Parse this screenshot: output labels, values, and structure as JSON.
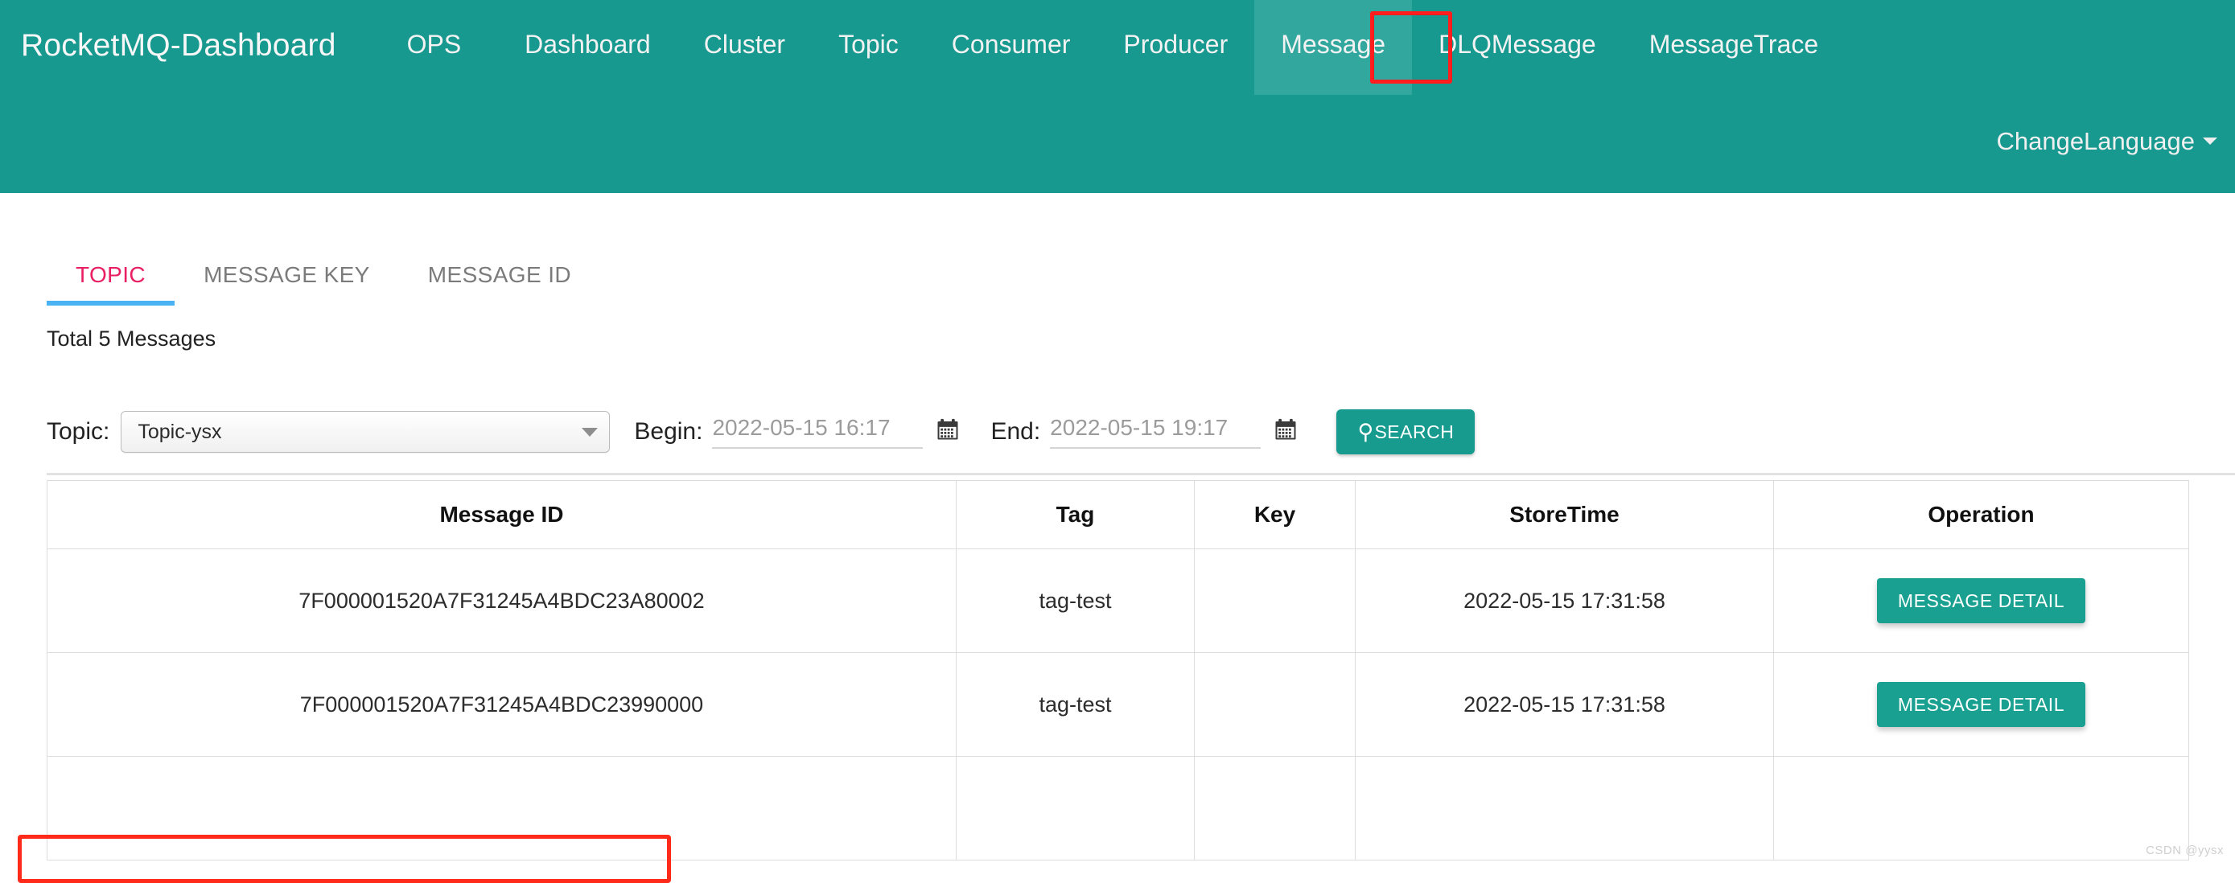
{
  "navbar": {
    "brand": "RocketMQ-Dashboard",
    "links": [
      {
        "label": "OPS",
        "active": false
      },
      {
        "label": "Dashboard",
        "active": false
      },
      {
        "label": "Cluster",
        "active": false
      },
      {
        "label": "Topic",
        "active": false
      },
      {
        "label": "Consumer",
        "active": false
      },
      {
        "label": "Producer",
        "active": false
      },
      {
        "label": "Message",
        "active": true
      },
      {
        "label": "DLQMessage",
        "active": false
      },
      {
        "label": "MessageTrace",
        "active": false
      }
    ],
    "language_menu": "ChangeLanguage",
    "caret_icon": "chevron-down-icon",
    "bg_color": "#17998f",
    "active_bg_color": "#31a79e"
  },
  "annotations": {
    "message_nav_highlight_color": "#ff1d1d",
    "topic_filter_highlight_color": "#ff2a1a"
  },
  "tabs": [
    {
      "label": "TOPIC",
      "active": true
    },
    {
      "label": "MESSAGE KEY",
      "active": false
    },
    {
      "label": "MESSAGE ID",
      "active": false
    }
  ],
  "tab_active_color": "#e91e63",
  "tab_underline_color": "#4ab3f4",
  "summary": "Total 5 Messages",
  "filters": {
    "topic_label": "Topic:",
    "topic_value": "Topic-ysx",
    "topic_caret_icon": "chevron-down-icon",
    "begin_label": "Begin:",
    "begin_value": "2022-05-15 16:17",
    "begin_calendar_icon": "calendar-icon",
    "end_label": "End:",
    "end_value": "2022-05-15 19:17",
    "end_calendar_icon": "calendar-icon",
    "search_button": "SEARCH",
    "search_icon": "search-icon",
    "search_button_color": "#169b8e"
  },
  "table": {
    "columns": [
      "Message ID",
      "Tag",
      "Key",
      "StoreTime",
      "Operation"
    ],
    "rows": [
      {
        "message_id": "7F000001520A7F31245A4BDC23A80002",
        "tag": "tag-test",
        "key": "",
        "store_time": "2022-05-15 17:31:58",
        "operation": "MESSAGE DETAIL"
      },
      {
        "message_id": "7F000001520A7F31245A4BDC23990000",
        "tag": "tag-test",
        "key": "",
        "store_time": "2022-05-15 17:31:58",
        "operation": "MESSAGE DETAIL"
      },
      {
        "message_id": "",
        "tag": "",
        "key": "",
        "store_time": "",
        "operation": ""
      }
    ],
    "detail_button_color": "#19a091"
  },
  "watermark": "CSDN @yysx"
}
